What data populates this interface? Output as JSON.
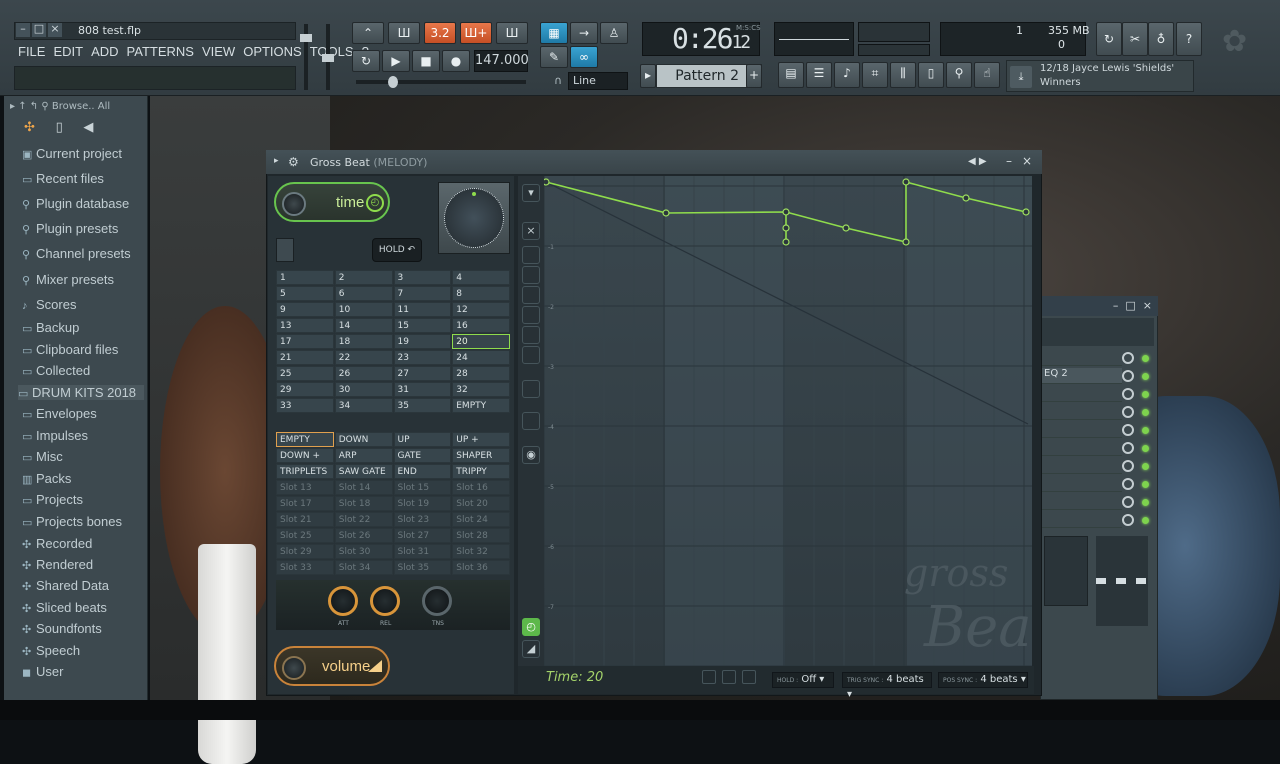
{
  "project": {
    "filename": "808 test.flp"
  },
  "menu": [
    "FILE",
    "EDIT",
    "ADD",
    "PATTERNS",
    "VIEW",
    "OPTIONS",
    "TOOLS",
    "?"
  ],
  "transport": {
    "mode_button": "3.2",
    "tempo": "147.000",
    "time": "0:26",
    "time_frames": "12",
    "time_unit": "M:S:CS",
    "snap_mode": "Line",
    "pattern": "Pattern 2"
  },
  "monitor": {
    "cpu": "1",
    "memory": "355 MB",
    "voices": "0"
  },
  "news": {
    "line1": "12/18  Jayce Lewis 'Shields'",
    "line2": "Winners"
  },
  "browser": {
    "header": "Browse..  All",
    "items": [
      {
        "label": "Current project",
        "icon": "project-icon"
      },
      {
        "label": "Recent files",
        "icon": "folder-icon"
      },
      {
        "label": "Plugin database",
        "icon": "plug-icon"
      },
      {
        "label": "Plugin presets",
        "icon": "plug-icon"
      },
      {
        "label": "Channel presets",
        "icon": "plug-icon"
      },
      {
        "label": "Mixer presets",
        "icon": "plug-icon"
      },
      {
        "label": "Scores",
        "icon": "note-icon"
      },
      {
        "label": "Backup",
        "icon": "folder-icon"
      },
      {
        "label": "Clipboard files",
        "icon": "folder-icon"
      },
      {
        "label": "Collected",
        "icon": "folder-icon"
      },
      {
        "label": "DRUM KITS 2018",
        "icon": "folder-icon"
      },
      {
        "label": "Envelopes",
        "icon": "folder-icon"
      },
      {
        "label": "Impulses",
        "icon": "folder-icon"
      },
      {
        "label": "Misc",
        "icon": "folder-icon"
      },
      {
        "label": "Packs",
        "icon": "pack-icon"
      },
      {
        "label": "Projects",
        "icon": "folder-icon"
      },
      {
        "label": "Projects bones",
        "icon": "folder-icon"
      },
      {
        "label": "Recorded",
        "icon": "plus-icon"
      },
      {
        "label": "Rendered",
        "icon": "plus-icon"
      },
      {
        "label": "Shared Data",
        "icon": "plus-icon"
      },
      {
        "label": "Sliced beats",
        "icon": "plus-icon"
      },
      {
        "label": "Soundfonts",
        "icon": "plus-icon"
      },
      {
        "label": "Speech",
        "icon": "plus-icon"
      },
      {
        "label": "User",
        "icon": "user-icon"
      }
    ]
  },
  "grossbeat": {
    "title": "Gross Beat",
    "subtitle": "(MELODY)",
    "time_label": "time",
    "volume_label": "volume",
    "hold_label": "HOLD",
    "time_presets": [
      "1",
      "2",
      "3",
      "4",
      "5",
      "6",
      "7",
      "8",
      "9",
      "10",
      "11",
      "12",
      "13",
      "14",
      "15",
      "16",
      "17",
      "18",
      "19",
      "20",
      "21",
      "22",
      "23",
      "24",
      "25",
      "26",
      "27",
      "28",
      "29",
      "30",
      "31",
      "32",
      "33",
      "34",
      "35",
      "EMPTY"
    ],
    "selected_time_preset": "20",
    "volume_presets": [
      "EMPTY",
      "DOWN",
      "UP",
      "UP +",
      "DOWN +",
      "ARP",
      "GATE",
      "SHAPER",
      "TRIPPLETS",
      "SAW GATE",
      "END",
      "TRIPPY",
      "Slot 13",
      "Slot 14",
      "Slot 15",
      "Slot 16",
      "Slot 17",
      "Slot 18",
      "Slot 19",
      "Slot 20",
      "Slot 21",
      "Slot 22",
      "Slot 23",
      "Slot 24",
      "Slot 25",
      "Slot 26",
      "Slot 27",
      "Slot 28",
      "Slot 29",
      "Slot 30",
      "Slot 31",
      "Slot 32",
      "Slot 33",
      "Slot 34",
      "Slot 35",
      "Slot 36"
    ],
    "envelope_knobs": [
      "ATT",
      "REL",
      "TNS"
    ],
    "status": "Time: 20",
    "hold": {
      "label": "HOLD :",
      "value": "Off"
    },
    "trig_sync": {
      "label": "TRIG SYNC :",
      "value": "4 beats"
    },
    "pos_sync": {
      "label": "POS SYNC :",
      "value": "4 beats"
    },
    "y_labels": [
      "-1",
      "-2",
      "-3",
      "-4",
      "-5",
      "-6",
      "-7"
    ],
    "watermark": "gross Beat"
  },
  "mixer": {
    "slot2": "EQ 2"
  },
  "colors": {
    "accent_green": "#8fdc4c",
    "accent_orange": "#e0a04e"
  }
}
